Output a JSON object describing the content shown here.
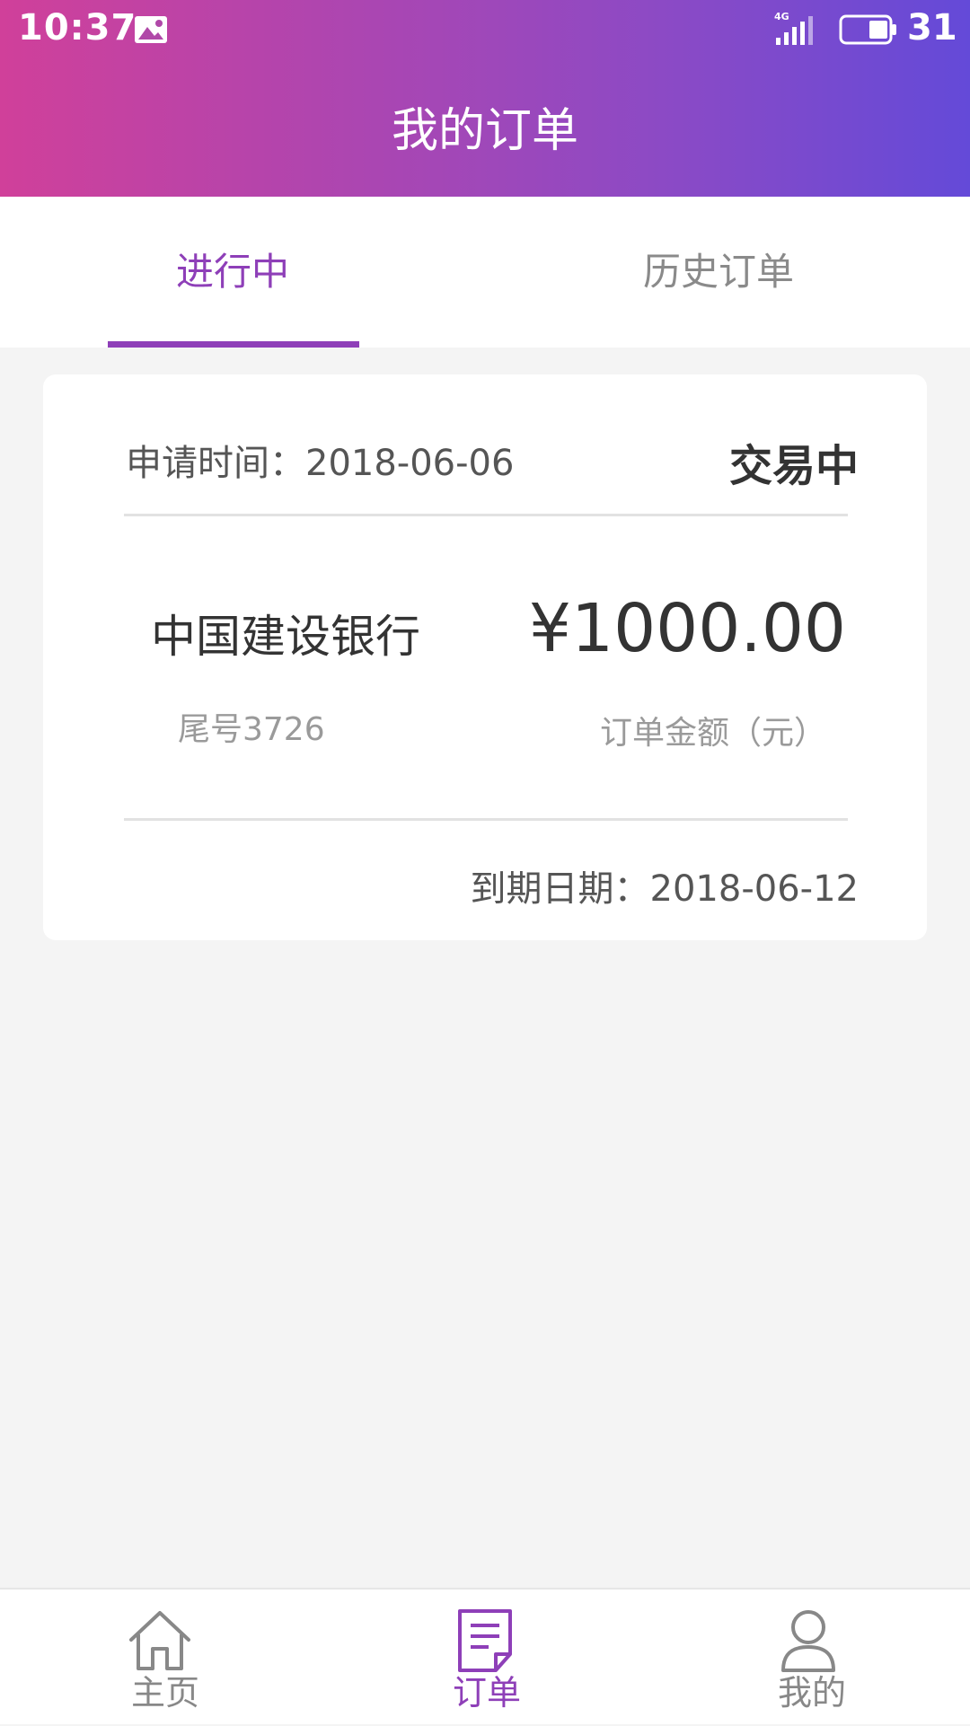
{
  "status_bar": {
    "time": "10:37",
    "network": "4G",
    "battery_level": "31",
    "icons": [
      "photo-notification-icon",
      "signal-icon",
      "battery-icon"
    ]
  },
  "header": {
    "title": "我的订单"
  },
  "tabs": [
    {
      "label": "进行中",
      "active": true
    },
    {
      "label": "历史订单",
      "active": false
    }
  ],
  "order": {
    "apply_time": "申请时间：2018-06-06",
    "status": "交易中",
    "bank_name": "中国建设银行",
    "card_tail": "尾号3726",
    "amount": "¥1000.00",
    "amount_label": "订单金额（元）",
    "due_date": "到期日期：2018-06-12"
  },
  "bottom_nav": [
    {
      "label": "主页",
      "icon": "home-icon",
      "active": false
    },
    {
      "label": "订单",
      "icon": "order-document-icon",
      "active": true
    },
    {
      "label": "我的",
      "icon": "user-icon",
      "active": false
    }
  ],
  "colors": {
    "accent": "#8e3fb8",
    "header_gradient_start": "#d0409a",
    "header_gradient_end": "#644ad8",
    "background": "#f4f4f4"
  }
}
